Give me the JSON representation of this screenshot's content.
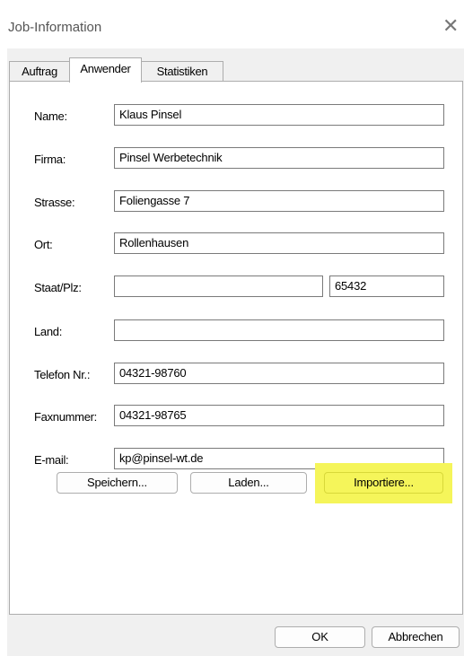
{
  "window": {
    "title": "Job-Information",
    "close_glyph": "✕"
  },
  "tabs": [
    {
      "label": "Auftrag",
      "active": false
    },
    {
      "label": "Anwender",
      "active": true
    },
    {
      "label": "Statistiken",
      "active": false
    }
  ],
  "form": {
    "name": {
      "label": "Name:",
      "value": "Klaus Pinsel"
    },
    "firma": {
      "label": "Firma:",
      "value": "Pinsel Werbetechnik"
    },
    "strasse": {
      "label": "Strasse:",
      "value": "Foliengasse 7"
    },
    "ort": {
      "label": "Ort:",
      "value": "Rollenhausen"
    },
    "staat_plz": {
      "label": "Staat/Plz:",
      "staat_value": "",
      "plz_value": "65432"
    },
    "land": {
      "label": "Land:",
      "value": ""
    },
    "telefon": {
      "label": "Telefon Nr.:",
      "value": "04321-98760"
    },
    "fax": {
      "label": "Faxnummer:",
      "value": "04321-98765"
    },
    "email": {
      "label": "E-mail:",
      "value": "kp@pinsel-wt.de"
    }
  },
  "actions": {
    "speichern": "Speichern...",
    "laden": "Laden...",
    "importiere": "Importiere..."
  },
  "footer": {
    "ok": "OK",
    "abbrechen": "Abbrechen"
  },
  "colors": {
    "highlight": "#f5f55a",
    "dialog_bg": "#f0f0f0",
    "border": "#adadad"
  }
}
